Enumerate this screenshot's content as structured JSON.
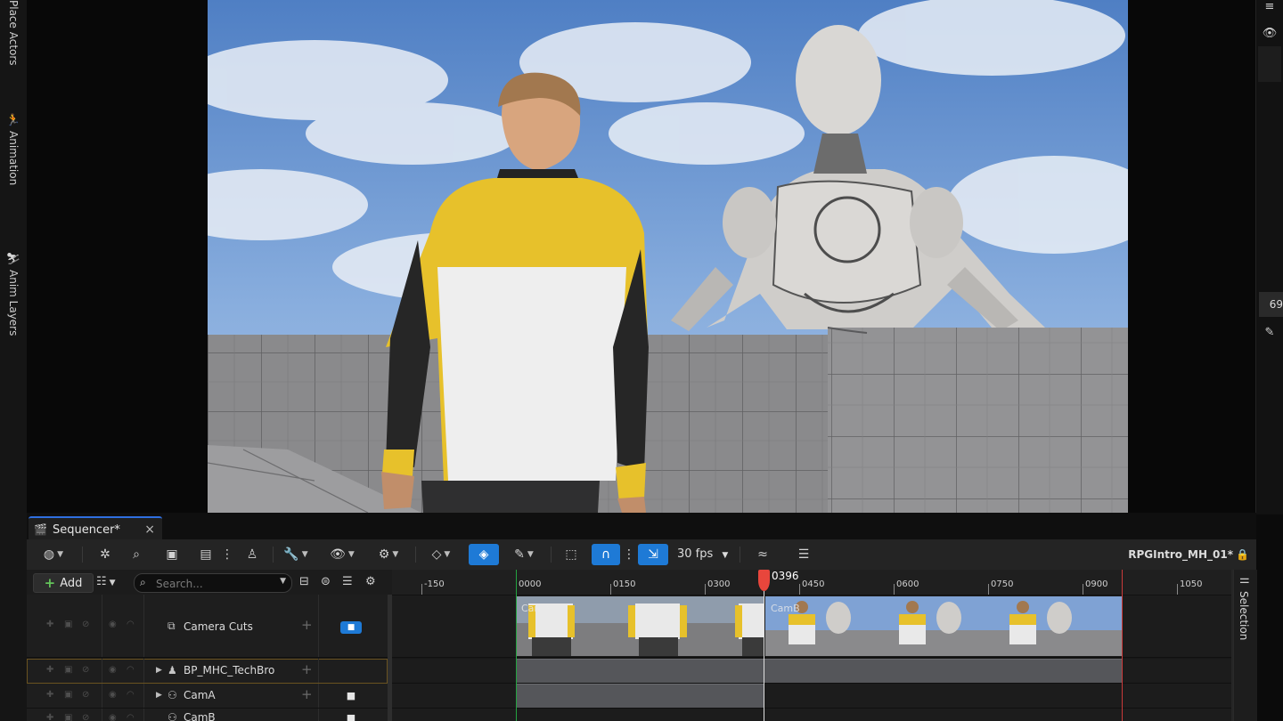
{
  "left_tabs": [
    {
      "label": "Place Actors",
      "icon": "cube-plus-icon"
    },
    {
      "label": "Animation",
      "icon": "running-figure-icon"
    },
    {
      "label": "Anim Layers",
      "icon": "anim-layers-icon"
    }
  ],
  "right_rail": {
    "value_readout": "69"
  },
  "sequencer": {
    "tab_label": "Sequencer*",
    "toolbar": {
      "fps": "30 fps",
      "sequence_name": "RPGIntro_MH_01*"
    },
    "outliner": {
      "add_label": "Add",
      "search_placeholder": "Search...",
      "tracks": [
        {
          "name": "Camera Cuts",
          "icon": "camera-cuts-icon"
        },
        {
          "name": "BP_MHC_TechBro",
          "icon": "character-icon"
        },
        {
          "name": "CamA",
          "icon": "camera-actor-icon"
        },
        {
          "name": "CamB",
          "icon": "camera-actor-icon"
        }
      ]
    },
    "timeline": {
      "ticks": [
        "-150",
        "0000",
        "0150",
        "0300",
        "0450",
        "0600",
        "0750",
        "0900",
        "1050"
      ],
      "playhead": "0396",
      "shots": [
        "CamA",
        "CamB"
      ]
    },
    "selection_tab": "Selection"
  },
  "colors": {
    "accent": "#1e7ad6",
    "playhead": "#e8463c",
    "start_marker": "#23a341",
    "end_marker": "#c93a3a",
    "jacket_yellow": "#e7c12b"
  }
}
